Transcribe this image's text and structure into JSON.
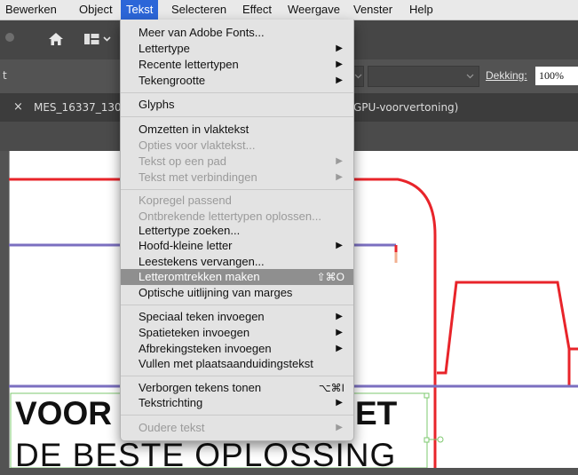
{
  "menubar": {
    "items": [
      "Bewerken",
      "Object",
      "Tekst",
      "Selecteren",
      "Effect",
      "Weergave",
      "Venster",
      "Help"
    ]
  },
  "control_bar": {
    "left_char": "t",
    "opacity_label": "Dekking:",
    "opacity_value": "100%"
  },
  "document_tab": {
    "close_glyph": "×",
    "name_prefix": "MES_16337_130",
    "mode_suffix": "GPU-voorvertoning)"
  },
  "menu": {
    "items": [
      {
        "label": "Meer van Adobe Fonts...",
        "enabled": true,
        "submenu": false,
        "shortcut": ""
      },
      {
        "label": "Lettertype",
        "enabled": true,
        "submenu": true,
        "shortcut": ""
      },
      {
        "label": "Recente lettertypen",
        "enabled": true,
        "submenu": true,
        "shortcut": ""
      },
      {
        "label": "Tekengrootte",
        "enabled": true,
        "submenu": true,
        "shortcut": ""
      },
      {
        "label": "Glyphs",
        "enabled": true,
        "submenu": false,
        "shortcut": ""
      },
      {
        "label": "Omzetten in vlaktekst",
        "enabled": true,
        "submenu": false,
        "shortcut": ""
      },
      {
        "label": "Opties voor vlaktekst...",
        "enabled": false,
        "submenu": false,
        "shortcut": ""
      },
      {
        "label": "Tekst op een pad",
        "enabled": false,
        "submenu": true,
        "shortcut": ""
      },
      {
        "label": "Tekst met verbindingen",
        "enabled": false,
        "submenu": true,
        "shortcut": ""
      },
      {
        "label": "Kopregel passend",
        "enabled": false,
        "submenu": false,
        "shortcut": ""
      },
      {
        "label": "Ontbrekende lettertypen oplossen...",
        "enabled": false,
        "submenu": false,
        "shortcut": ""
      },
      {
        "label": "Lettertype zoeken...",
        "enabled": true,
        "submenu": false,
        "shortcut": ""
      },
      {
        "label": "Hoofd-kleine letter",
        "enabled": true,
        "submenu": true,
        "shortcut": ""
      },
      {
        "label": "Leestekens vervangen...",
        "enabled": true,
        "submenu": false,
        "shortcut": ""
      },
      {
        "label": "Letteromtrekken maken",
        "enabled": true,
        "submenu": false,
        "shortcut": "⇧⌘O",
        "highlighted": true
      },
      {
        "label": "Optische uitlijning van marges",
        "enabled": true,
        "submenu": false,
        "shortcut": ""
      },
      {
        "label": "Speciaal teken invoegen",
        "enabled": true,
        "submenu": true,
        "shortcut": ""
      },
      {
        "label": "Spatieteken invoegen",
        "enabled": true,
        "submenu": true,
        "shortcut": ""
      },
      {
        "label": "Afbrekingsteken invoegen",
        "enabled": true,
        "submenu": true,
        "shortcut": ""
      },
      {
        "label": "Vullen met plaatsaanduidingstekst",
        "enabled": true,
        "submenu": false,
        "shortcut": ""
      },
      {
        "label": "Verborgen tekens tonen",
        "enabled": true,
        "submenu": false,
        "shortcut": "⌥⌘I"
      },
      {
        "label": "Tekstrichting",
        "enabled": true,
        "submenu": true,
        "shortcut": ""
      },
      {
        "label": "Oudere tekst",
        "enabled": false,
        "submenu": true,
        "shortcut": ""
      }
    ]
  },
  "artboard_text": {
    "line1_left": "VOOR",
    "line1_right": "ET",
    "line2": "DE BESTE OPLOSSING"
  },
  "colors": {
    "accent": "#2c66d8",
    "highlight": "#8f8f8f",
    "dieline_red": "#e8242a",
    "fold_purple": "#7b6fc0",
    "selection_green": "#7ec86f"
  },
  "icons": {
    "home": "home-icon",
    "workspace": "workspace-switcher-icon",
    "submenu": "chevron-right-icon",
    "close": "close-icon"
  }
}
